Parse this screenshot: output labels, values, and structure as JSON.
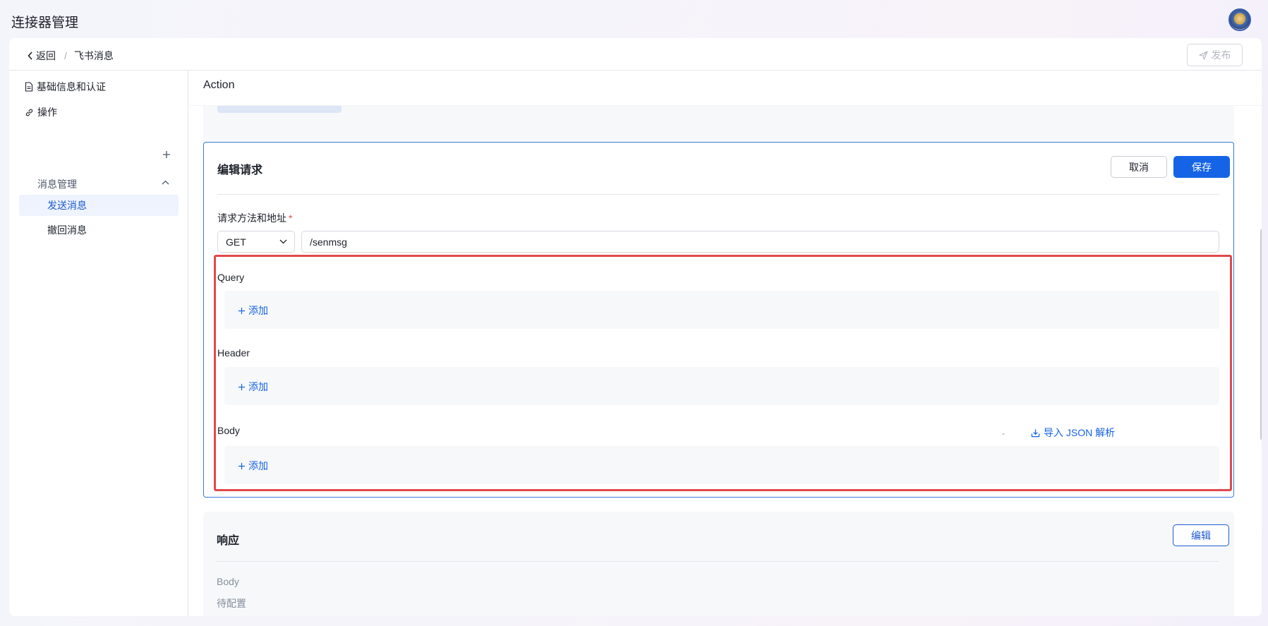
{
  "app": {
    "title": "连接器管理"
  },
  "breadcrumb": {
    "back_label": "返回",
    "separator": "/",
    "current": "飞书消息"
  },
  "toolbar": {
    "publish_label": "发布"
  },
  "sidebar": {
    "basic_info": "基础信息和认证",
    "operations": "操作",
    "group": "消息管理",
    "items": [
      {
        "label": "发送消息",
        "active": true
      },
      {
        "label": "撤回消息",
        "active": false
      }
    ]
  },
  "main": {
    "header": "Action"
  },
  "edit_request": {
    "title": "编辑请求",
    "cancel_label": "取消",
    "save_label": "保存",
    "method_label": "请求方法和地址",
    "required_mark": "*",
    "method": "GET",
    "url": "/senmsg",
    "query_label": "Query",
    "header_label": "Header",
    "body_label": "Body",
    "add_label": "添加",
    "import_dash": "-",
    "import_json_label": "导入 JSON 解析"
  },
  "response": {
    "title": "响应",
    "edit_label": "编辑",
    "body_label": "Body",
    "body_value": "待配置"
  },
  "colors": {
    "accent": "#1664e6",
    "highlight_border": "#e2494b",
    "panel_border": "#3c7ad8"
  }
}
